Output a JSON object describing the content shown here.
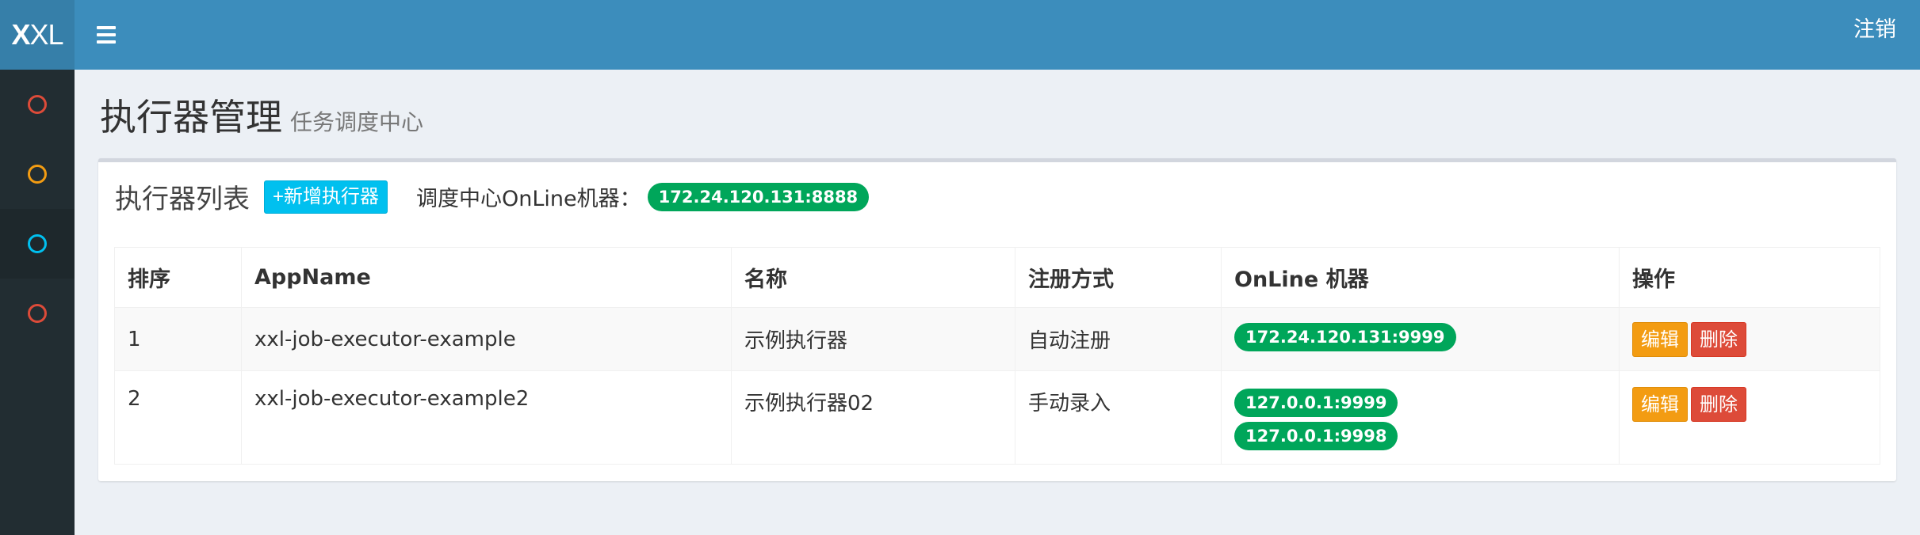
{
  "logo": {
    "bold": "X",
    "rest": "XL"
  },
  "header": {
    "logout_label": "注销"
  },
  "sidebar": {
    "items": [
      {
        "icon": "circle-outline-icon",
        "color": "#dd4b39",
        "active": false
      },
      {
        "icon": "circle-outline-icon",
        "color": "#f39c12",
        "active": false
      },
      {
        "icon": "circle-outline-icon",
        "color": "#00c0ef",
        "active": true
      },
      {
        "icon": "circle-outline-icon",
        "color": "#dd4b39",
        "active": false
      }
    ]
  },
  "page": {
    "title": "执行器管理",
    "subtitle": "任务调度中心"
  },
  "box": {
    "title": "执行器列表",
    "add_button": "+新增执行器",
    "online_label": "调度中心OnLine机器：",
    "online_machine": "172.24.120.131:8888"
  },
  "table": {
    "headers": [
      "排序",
      "AppName",
      "名称",
      "注册方式",
      "OnLine 机器",
      "操作"
    ],
    "rows": [
      {
        "order": "1",
        "appname": "xxl-job-executor-example",
        "name": "示例执行器",
        "type": "自动注册",
        "machines": [
          "172.24.120.131:9999"
        ],
        "edit": "编辑",
        "delete": "删除"
      },
      {
        "order": "2",
        "appname": "xxl-job-executor-example2",
        "name": "示例执行器02",
        "type": "手动录入",
        "machines": [
          "127.0.0.1:9999",
          "127.0.0.1:9998"
        ],
        "edit": "编辑",
        "delete": "删除"
      }
    ]
  },
  "colors": {
    "header_bg": "#3c8dbc",
    "logo_bg": "#367fa9",
    "sidebar_bg": "#222d32",
    "success": "#00a65a",
    "info": "#00c0ef",
    "warning": "#f39c12",
    "danger": "#dd4b39"
  }
}
